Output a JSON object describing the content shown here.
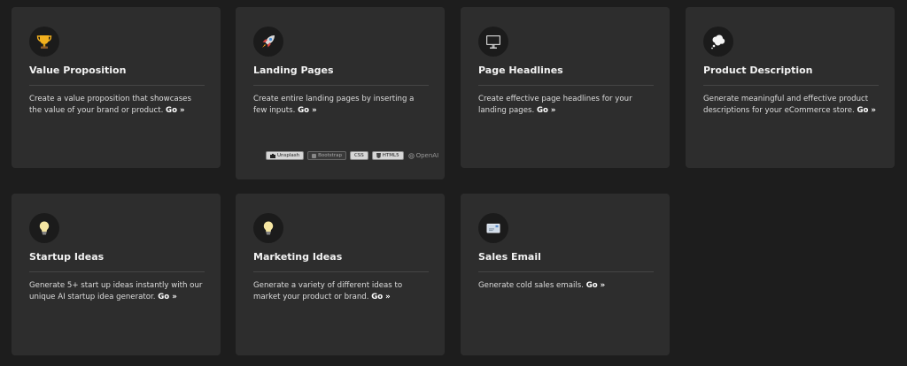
{
  "cards": [
    {
      "title": "Value Proposition",
      "description": "Create a value proposition that showcases the value of your brand or product.",
      "link": "Go »",
      "icon": "trophy-icon"
    },
    {
      "title": "Landing Pages",
      "description": "Create entire landing pages by inserting a few inputs.",
      "link": "Go »",
      "icon": "rocket-icon",
      "badges": [
        "Unsplash",
        "Bootstrap",
        "CSS",
        "HTML5",
        "OpenAI"
      ]
    },
    {
      "title": "Page Headlines",
      "description": "Create effective page headlines for your landing pages.",
      "link": "Go »",
      "icon": "monitor-icon"
    },
    {
      "title": "Product Description",
      "description": "Generate meaningful and effective product descriptions for your eCommerce store.",
      "link": "Go »",
      "icon": "thought-bubble-icon"
    },
    {
      "title": "Startup Ideas",
      "description": "Generate 5+ start up ideas instantly with our unique AI startup idea generator.",
      "link": "Go »",
      "icon": "lightbulb-icon"
    },
    {
      "title": "Marketing Ideas",
      "description": "Generate a variety of different ideas to market your product or brand.",
      "link": "Go »",
      "icon": "lightbulb-icon"
    },
    {
      "title": "Sales Email",
      "description": "Generate cold sales emails.",
      "link": "Go »",
      "icon": "email-icon"
    }
  ],
  "colors": {
    "background": "#1d1d1d",
    "card": "#2d2d2d",
    "icon_circle": "#1b1b1b",
    "text": "#f2f2f2"
  }
}
